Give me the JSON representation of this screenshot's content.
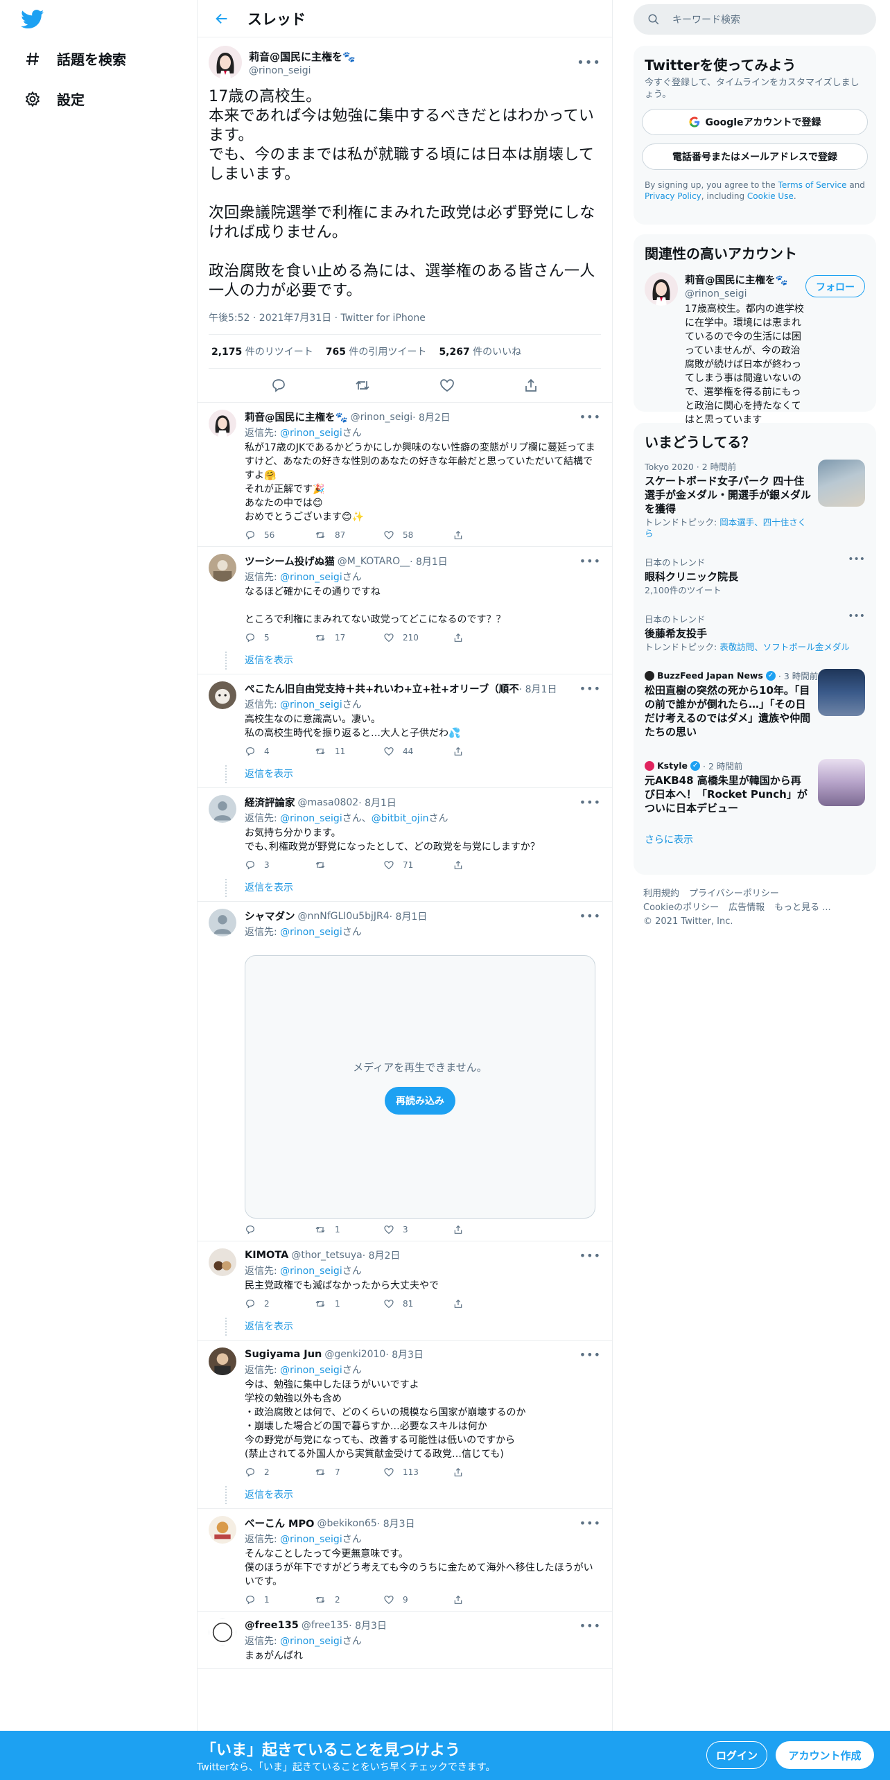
{
  "nav": {
    "explore": "話題を検索",
    "settings": "設定"
  },
  "header": {
    "title": "スレッド"
  },
  "main_tweet": {
    "name": "莉音@国民に主権を🐾",
    "handle": "@rinon_seigi",
    "text": "17歳の高校生。\n本来であれば今は勉強に集中するべきだとはわかっています。\nでも、今のままでは私が就職する頃には日本は崩壊してしまいます。\n\n次回衆議院選挙で利権にまみれた政党は必ず野党にしなければ成りません。\n\n政治腐敗を食い止める為には、選挙権のある皆さん一人一人の力が必要です。",
    "meta": "午後5:52 · 2021年7月31日 · Twitter for iPhone",
    "retweets_count": "2,175",
    "retweets_label": " 件のリツイート",
    "quotes_count": "765",
    "quotes_label": " 件の引用ツイート",
    "likes_count": "5,267",
    "likes_label": " 件のいいね"
  },
  "replies": [
    {
      "name": "莉音@国民に主権を🐾",
      "handle": "@rinon_seigi",
      "date": " · 8月2日",
      "to_prefix": "返信先: ",
      "to": "@rinon_seigi",
      "to_suffix": "さん",
      "text": "私が17歳のJKであるかどうかにしか興味のない性癖の変態がリプ欄に蔓延ってますけど、あなたの好きな性別のあなたの好きな年齢だと思っていただいて結構ですよ🤗\nそれが正解です🎉\nあなたの中では😊\nおめでとうございます😊✨",
      "replies": "56",
      "retweets": "87",
      "likes": "58"
    },
    {
      "name": "ツーシーム投げぬ猫",
      "handle": "@M_KOTARO__",
      "date": " · 8月1日",
      "to_prefix": "返信先: ",
      "to": "@rinon_seigi",
      "to_suffix": "さん",
      "text": "なるほど確かにその通りですね\n\nところで利権にまみれてない政党ってどこになるのです？？",
      "replies": "5",
      "retweets": "17",
      "likes": "210",
      "show_replies": "返信を表示"
    },
    {
      "name": "ぺこたん旧自由党支持＋共+れいわ+立+社+オリーブ（順不",
      "handle": "",
      "date": " · 8月1日",
      "to_prefix": "返信先: ",
      "to": "@rinon_seigi",
      "to_suffix": "さん",
      "text": "高校生なのに意識高い。凄い。\n私の高校生時代を振り返ると…大人と子供だわ💦",
      "replies": "4",
      "retweets": "11",
      "likes": "44",
      "show_replies": "返信を表示"
    },
    {
      "name": "経済評論家",
      "handle": "@masa0802",
      "date": " · 8月1日",
      "to_prefix": "返信先: ",
      "to": "@rinon_seigi",
      "to_mid": "さん、",
      "to2": "@bitbit_ojin",
      "to_suffix": "さん",
      "text": "お気持ち分かります。\nでも､利権政党が野党になったとして、どの政党を与党にしますか？",
      "replies": "3",
      "retweets": "",
      "likes": "71",
      "show_replies": "返信を表示"
    },
    {
      "name": "シャマダン",
      "handle": "@nnNfGLI0u5bjJR4",
      "date": " · 8月1日",
      "to_prefix": "返信先: ",
      "to": "@rinon_seigi",
      "to_suffix": "さん",
      "media_message": "メディアを再生できません。",
      "media_reload": "再読み込み",
      "replies": "",
      "retweets": "1",
      "likes": "3"
    },
    {
      "name": "KIMOTA",
      "handle": "@thor_tetsuya",
      "date": " · 8月2日",
      "to_prefix": "返信先: ",
      "to": "@rinon_seigi",
      "to_suffix": "さん",
      "text": "民主党政権でも滅ばなかったから大丈夫やで",
      "replies": "2",
      "retweets": "1",
      "likes": "81",
      "show_replies": "返信を表示"
    },
    {
      "name": "Sugiyama Jun",
      "handle": "@genki2010",
      "date": " · 8月3日",
      "to_prefix": "返信先: ",
      "to": "@rinon_seigi",
      "to_suffix": "さん",
      "text": "今は、勉強に集中したほうがいいですよ\n学校の勉強以外も含め\n・政治腐敗とは何で、どのくらいの規模なら国家が崩壊するのか\n・崩壊した場合どの国で暮らすか…必要なスキルは何か\n今の野党が与党になっても、改善する可能性は低いのですから\n(禁止されてる外国人から実質献金受けてる政党…信じても)",
      "replies": "2",
      "retweets": "7",
      "likes": "113",
      "show_replies": "返信を表示"
    },
    {
      "name": "べーこん MPO",
      "handle": "@bekikon65",
      "date": " · 8月3日",
      "to_prefix": "返信先: ",
      "to": "@rinon_seigi",
      "to_suffix": "さん",
      "text": "そんなことしたって今更無意味です。\n僕のほうが年下ですがどう考えても今のうちに金ためて海外へ移住したほうがいいです。",
      "replies": "1",
      "retweets": "2",
      "likes": "9"
    },
    {
      "name": "@free135",
      "handle": "@free135",
      "date": " · 8月3日",
      "to_prefix": "返信先: ",
      "to": "@rinon_seigi",
      "to_suffix": "さん",
      "text": "まぁがんばれ"
    }
  ],
  "search": {
    "placeholder": "キーワード検索"
  },
  "signup_card": {
    "title": "Twitterを使ってみよう",
    "subtitle": "今すぐ登録して、タイムラインをカスタマイズしましょう。",
    "google_button": "Googleアカウントで登録",
    "phone_button": "電話番号またはメールアドレスで登録",
    "legal_prefix": "By signing up, you agree to the ",
    "terms": "Terms of Service",
    "legal_and": " and ",
    "privacy": "Privacy Policy",
    "legal_including": ", including ",
    "cookie": "Cookie Use",
    "legal_end": "."
  },
  "related": {
    "title": "関連性の高いアカウント",
    "name": "莉音@国民に主権を🐾",
    "handle": "@rinon_seigi",
    "bio": "17歳高校生。都内の進学校に在学中。環境には恵まれているので今の生活には困っていませんが、今の政治腐敗が続けば日本が終わってしまう事は間違いないので、選挙権を得る前にもっと政治に関心を持たなくてはと思っています",
    "follow": "フォロー"
  },
  "trends": {
    "title": "いまどうしてる？",
    "items": [
      {
        "context": "Tokyo 2020 · 2 時間前",
        "title": "スケートボード女子パーク 四十住選手が金メダル・開選手が銀メダルを獲得",
        "sub_prefix": "トレンドトピック: ",
        "sub_link": "岡本選手、四十住さくら"
      },
      {
        "context": "日本のトレンド",
        "title": "眼科クリニック院長",
        "sub_plain": "2,100件のツイート"
      },
      {
        "context": "日本のトレンド",
        "title": "後藤希友投手",
        "sub_prefix": "トレンドトピック: ",
        "sub_link": "表敬訪問、ソフトボール金メダル"
      },
      {
        "context_source": "BuzzFeed Japan News",
        "context_time": " · 3 時間前",
        "title": "松田直樹の突然の死から10年。「目の前で誰かが倒れたら…」「その日だけ考えるのではダメ」遺族や仲間たちの思い"
      },
      {
        "context_source": "Kstyle",
        "context_time": " · 2 時間前",
        "title": "元AKB48 高橋朱里が韓国から再び日本へ！「Rocket Punch」がついに日本デビュー"
      }
    ],
    "show_more": "さらに表示"
  },
  "footer": {
    "links": [
      "利用規約",
      "プライバシーポリシー",
      "Cookieのポリシー",
      "広告情報",
      "もっと見る ..."
    ],
    "copyright": "© 2021 Twitter, Inc."
  },
  "bottom_bar": {
    "title": "「いま」起きていることを見つけよう",
    "subtitle": "Twitterなら、「いま」起きていることをいち早くチェックできます。",
    "login": "ログイン",
    "signup": "アカウント作成"
  },
  "colors": {
    "brand": "#1da1f2",
    "link": "#1b95e0",
    "muted": "#5b7083"
  }
}
